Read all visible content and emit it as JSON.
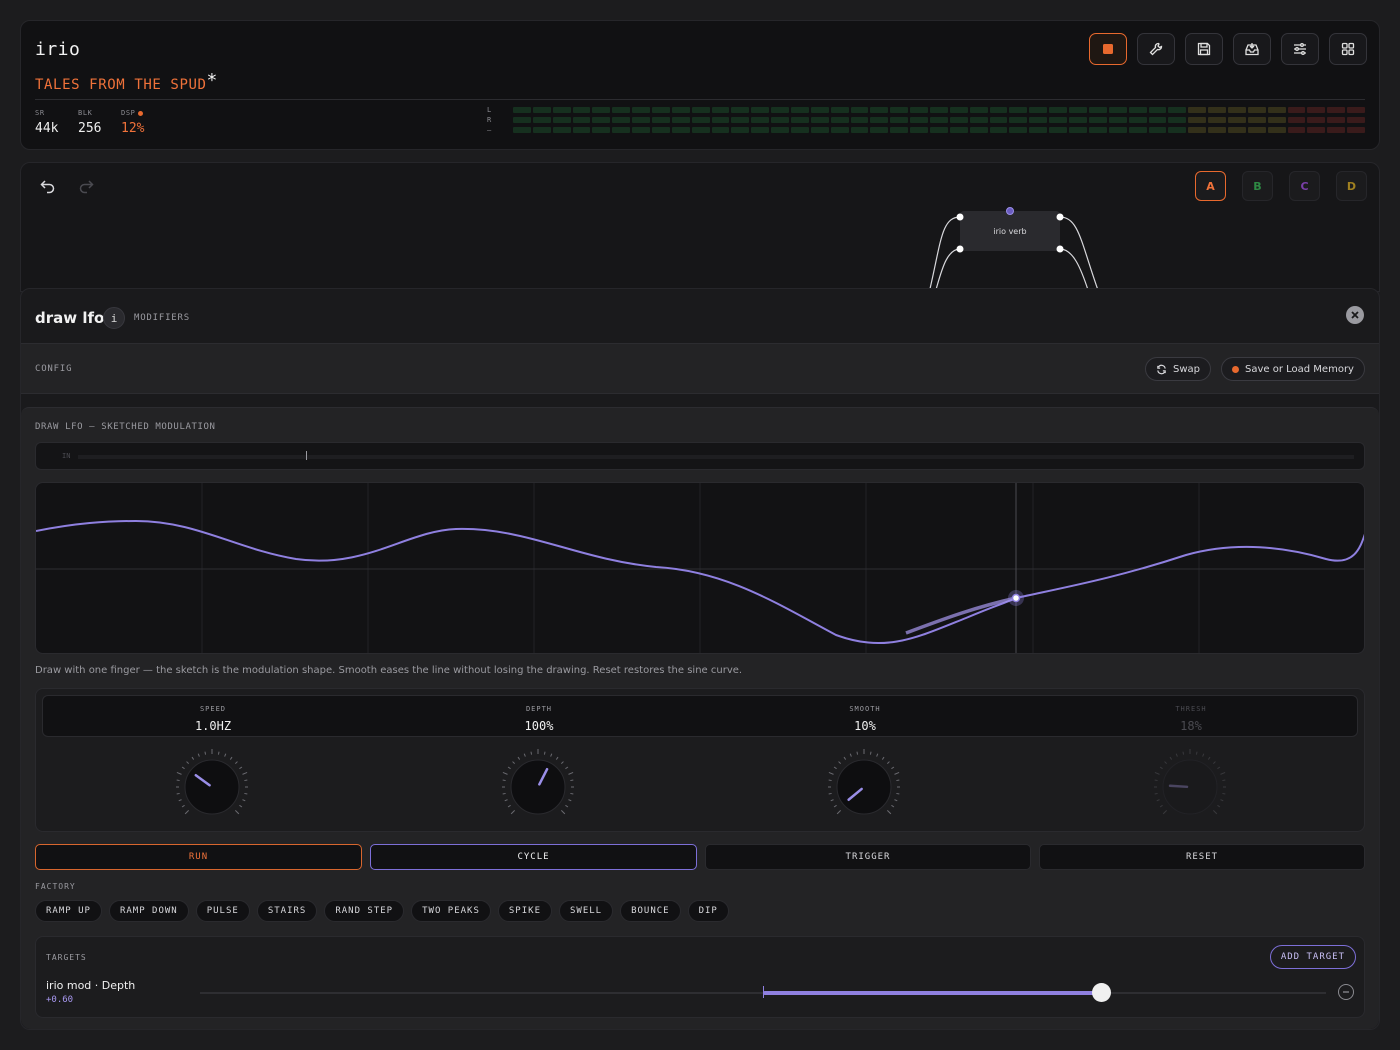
{
  "header": {
    "app_name": "irio",
    "song_title": "TALES FROM THE SPUD",
    "modified_mark": "*",
    "toolbar": [
      {
        "icon": "stop-icon",
        "active": true
      },
      {
        "icon": "wrench-icon",
        "active": false
      },
      {
        "icon": "save-icon",
        "active": false
      },
      {
        "icon": "inbox-icon",
        "active": false
      },
      {
        "icon": "sliders-icon",
        "active": false
      },
      {
        "icon": "grid-icon",
        "active": false
      }
    ],
    "stats": {
      "sr_label": "SR",
      "sr_value": "44k",
      "blk_label": "BLK",
      "blk_value": "256",
      "dsp_label": "DSP",
      "dsp_value": "12%"
    },
    "meter_labels": {
      "left": "L",
      "right": "R",
      "third": "—"
    }
  },
  "graph": {
    "scenes": [
      {
        "label": "A",
        "color": "#f0723a",
        "active": true
      },
      {
        "label": "B",
        "color": "#2e8a44",
        "active": false
      },
      {
        "label": "C",
        "color": "#7a3fa8",
        "active": false
      },
      {
        "label": "D",
        "color": "#a08020",
        "active": false
      }
    ],
    "node_label": "irio verb"
  },
  "module": {
    "title": "draw lfo",
    "info_label": "i",
    "tag": "MODIFIERS",
    "config_label": "CONFIG",
    "swap_label": "Swap",
    "memory_label": "Save or Load Memory",
    "section_label": "DRAW LFO — SKETCHED MODULATION",
    "in_label": "IN",
    "hint": "Draw with one finger — the sketch is the modulation shape. Smooth eases the line without losing the drawing. Reset restores the sine curve.",
    "knobs": [
      {
        "label": "SPEED",
        "value": "1.0HZ",
        "level": 0.3,
        "enabled": true
      },
      {
        "label": "DEPTH",
        "value": "100%",
        "level": 0.6,
        "enabled": true
      },
      {
        "label": "SMOOTH",
        "value": "10%",
        "level": 0.02,
        "enabled": true
      },
      {
        "label": "THRESH",
        "value": "18%",
        "level": 0.18,
        "enabled": false
      }
    ],
    "playback": {
      "run": "RUN",
      "cycle": "CYCLE",
      "trigger": "TRIGGER",
      "reset": "RESET"
    },
    "factory_label": "FACTORY",
    "factory": [
      "RAMP UP",
      "RAMP DOWN",
      "PULSE",
      "STAIRS",
      "RAND STEP",
      "TWO PEAKS",
      "SPIKE",
      "SWELL",
      "BOUNCE",
      "DIP"
    ],
    "targets": {
      "label": "TARGETS",
      "add_label": "ADD TARGET",
      "items": [
        {
          "name": "irio mod · Depth",
          "value": "+0.60",
          "amount": 0.6
        }
      ]
    }
  },
  "colors": {
    "accent": "#e8692e",
    "lfo": "#8f80e0",
    "panel": "#111113"
  }
}
